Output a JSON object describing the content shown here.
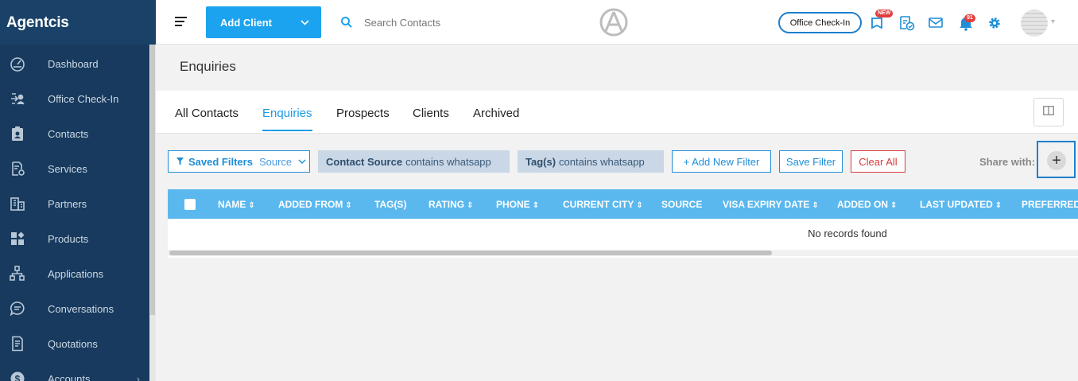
{
  "brand": "Agentcis",
  "sidebar": {
    "items": [
      {
        "label": "Dashboard",
        "icon": "gauge-icon"
      },
      {
        "label": "Office Check-In",
        "icon": "check-in-icon"
      },
      {
        "label": "Contacts",
        "icon": "contact-card-icon"
      },
      {
        "label": "Services",
        "icon": "services-icon"
      },
      {
        "label": "Partners",
        "icon": "building-icon"
      },
      {
        "label": "Products",
        "icon": "products-icon"
      },
      {
        "label": "Applications",
        "icon": "workflow-icon"
      },
      {
        "label": "Conversations",
        "icon": "chat-icon"
      },
      {
        "label": "Quotations",
        "icon": "document-icon"
      },
      {
        "label": "Accounts",
        "icon": "dollar-icon",
        "has_submenu": true
      }
    ]
  },
  "topbar": {
    "add_client_label": "Add Client",
    "search_placeholder": "Search Contacts",
    "office_checkin_label": "Office Check-In",
    "new_badge": "NEW",
    "notification_count": "91"
  },
  "page": {
    "title": "Enquiries"
  },
  "tabs": [
    {
      "label": "All Contacts",
      "active": false
    },
    {
      "label": "Enquiries",
      "active": true
    },
    {
      "label": "Prospects",
      "active": false
    },
    {
      "label": "Clients",
      "active": false
    },
    {
      "label": "Archived",
      "active": false
    }
  ],
  "filters": {
    "saved_filters_label": "Saved Filters",
    "saved_filters_value": "Source",
    "chip1_field": "Contact Source",
    "chip1_rest": "contains whatsapp",
    "chip2_field": "Tag(s)",
    "chip2_rest": "contains whatsapp",
    "add_new_filter": "+ Add New Filter",
    "save_filter": "Save Filter",
    "clear_all": "Clear All",
    "share_with": "Share with:"
  },
  "table": {
    "columns": [
      "NAME",
      "ADDED FROM",
      "TAG(S)",
      "RATING",
      "PHONE",
      "CURRENT CITY",
      "SOURCE",
      "VISA EXPIRY DATE",
      "ADDED ON",
      "LAST UPDATED",
      "PREFERRED"
    ],
    "empty_text": "No records found"
  },
  "colors": {
    "sidebar_bg": "#173a5e",
    "accent": "#1ba3ef",
    "table_header": "#5ab8ef",
    "danger": "#d83a3a"
  }
}
